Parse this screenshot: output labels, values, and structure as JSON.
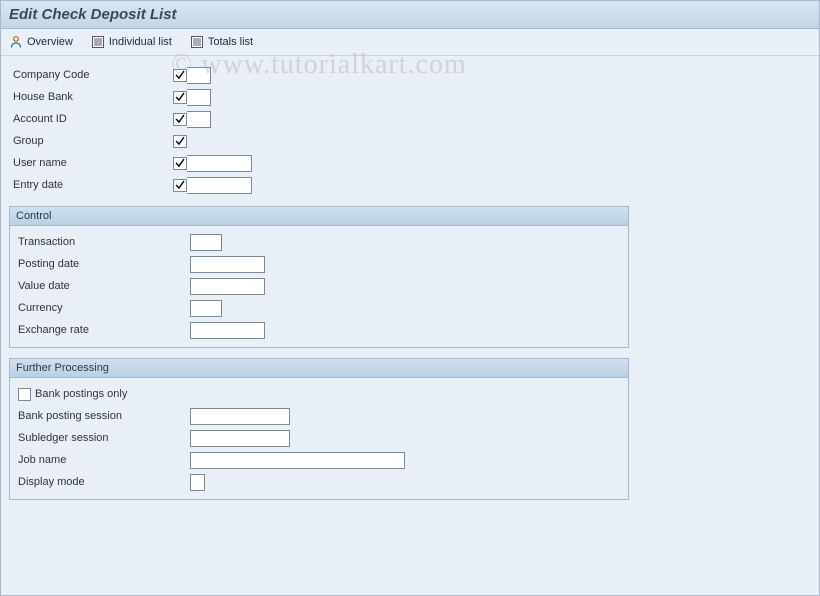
{
  "title": "Edit Check Deposit List",
  "toolbar": {
    "overview": "Overview",
    "individual": "Individual list",
    "totals": "Totals list"
  },
  "topFields": {
    "companyCode": {
      "label": "Company Code",
      "checked": true,
      "value": ""
    },
    "houseBank": {
      "label": "House Bank",
      "checked": true,
      "value": ""
    },
    "accountId": {
      "label": "Account ID",
      "checked": true,
      "value": ""
    },
    "group": {
      "label": "Group",
      "checked": true,
      "value": ""
    },
    "userName": {
      "label": "User name",
      "checked": true,
      "value": ""
    },
    "entryDate": {
      "label": "Entry date",
      "checked": true,
      "value": ""
    }
  },
  "control": {
    "header": "Control",
    "transaction": {
      "label": "Transaction",
      "value": ""
    },
    "postingDate": {
      "label": "Posting date",
      "value": ""
    },
    "valueDate": {
      "label": "Value date",
      "value": ""
    },
    "currency": {
      "label": "Currency",
      "value": ""
    },
    "exchangeRate": {
      "label": "Exchange rate",
      "value": ""
    }
  },
  "further": {
    "header": "Further Processing",
    "bankPostingsOnly": {
      "label": "Bank postings only",
      "checked": false
    },
    "bankPostingSession": {
      "label": "Bank posting session",
      "value": ""
    },
    "subledgerSession": {
      "label": "Subledger session",
      "value": ""
    },
    "jobName": {
      "label": "Job name",
      "value": ""
    },
    "displayMode": {
      "label": "Display mode",
      "value": ""
    }
  },
  "watermark": "© www.tutorialkart.com"
}
